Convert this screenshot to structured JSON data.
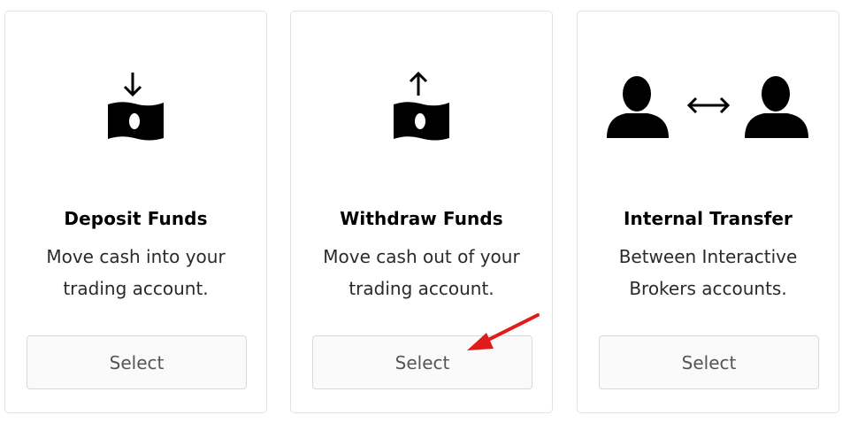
{
  "cards": [
    {
      "title": "Deposit Funds",
      "description": "Move cash into your trading account.",
      "button_label": "Select",
      "icon": "deposit-money-icon"
    },
    {
      "title": "Withdraw Funds",
      "description": "Move cash out of your trading account.",
      "button_label": "Select",
      "icon": "withdraw-money-icon"
    },
    {
      "title": "Internal Transfer",
      "description": "Between Interactive Brokers accounts.",
      "button_label": "Select",
      "icon": "user-transfer-icon"
    }
  ],
  "annotation": {
    "arrow_color": "#e11b1b",
    "points_to": "withdraw-select-button"
  }
}
